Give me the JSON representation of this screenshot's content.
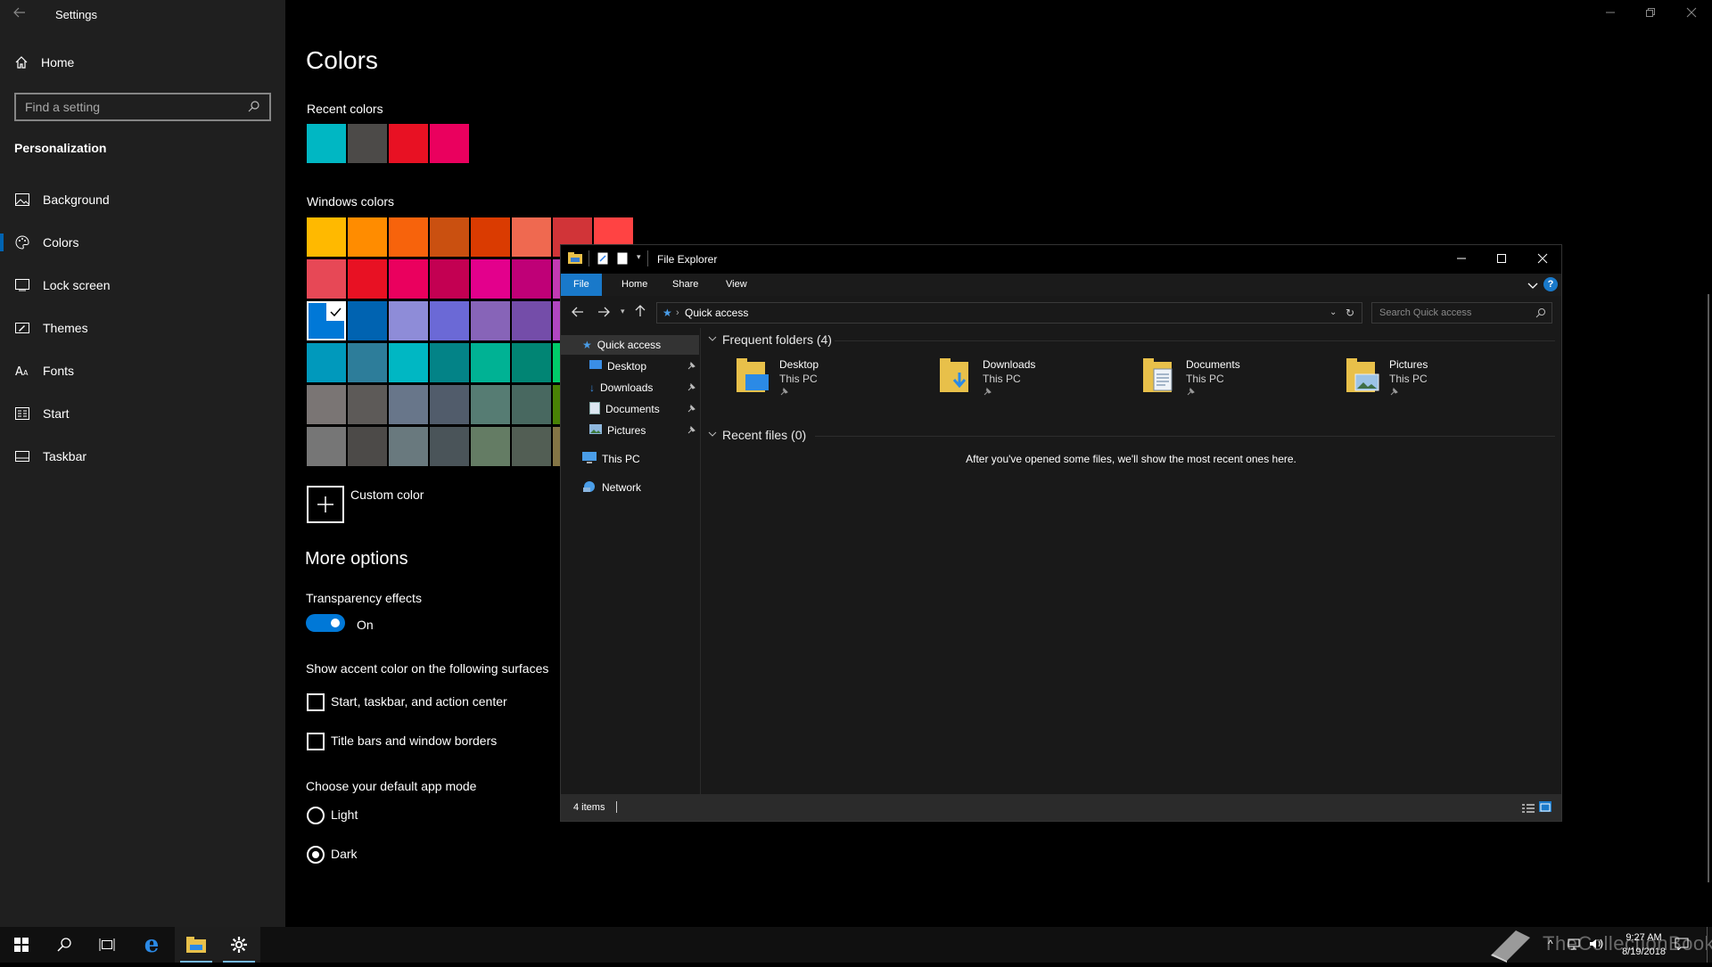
{
  "settings": {
    "window_title": "Settings",
    "home_label": "Home",
    "search_placeholder": "Find a setting",
    "section_label": "Personalization",
    "nav": [
      {
        "label": "Background",
        "icon": "picture-icon"
      },
      {
        "label": "Colors",
        "icon": "palette-icon",
        "active": true
      },
      {
        "label": "Lock screen",
        "icon": "lock-screen-icon"
      },
      {
        "label": "Themes",
        "icon": "brush-icon"
      },
      {
        "label": "Fonts",
        "icon": "font-icon"
      },
      {
        "label": "Start",
        "icon": "start-grid-icon"
      },
      {
        "label": "Taskbar",
        "icon": "taskbar-icon"
      }
    ],
    "page_title": "Colors",
    "recent_colors_label": "Recent colors",
    "recent_colors": [
      "#00b7c3",
      "#4c4a48",
      "#e81123",
      "#ea005e"
    ],
    "windows_colors_label": "Windows colors",
    "windows_colors": [
      [
        "#ffb900",
        "#ff8c00",
        "#f7630c",
        "#ca5010",
        "#da3b01",
        "#ef6950",
        "#d13438",
        "#ff4343"
      ],
      [
        "#e74856",
        "#e81123",
        "#ea005e",
        "#c30052",
        "#e3008c",
        "#bf0077",
        "#c239b3",
        "#9a0089"
      ],
      [
        "#0078d7",
        "#0063b1",
        "#8e8cd8",
        "#6b69d6",
        "#8764b8",
        "#744da9",
        "#b146c2",
        "#881798"
      ],
      [
        "#0099bc",
        "#2d7d9a",
        "#00b7c3",
        "#038387",
        "#00b294",
        "#018574",
        "#00cc6a",
        "#10893e"
      ],
      [
        "#7a7574",
        "#5d5a58",
        "#68768a",
        "#515c6b",
        "#567c73",
        "#486860",
        "#498205",
        "#107c10"
      ],
      [
        "#767676",
        "#4c4a48",
        "#69797e",
        "#4a5459",
        "#647c64",
        "#525e54",
        "#847545",
        "#7e735f"
      ]
    ],
    "selected_color": "#0078d7",
    "custom_color_label": "Custom color",
    "more_options_label": "More options",
    "transparency_label": "Transparency effects",
    "transparency_state": "On",
    "accent_surfaces_label": "Show accent color on the following surfaces",
    "checkbox_start": "Start, taskbar, and action center",
    "checkbox_titlebars": "Title bars and window borders",
    "app_mode_label": "Choose your default app mode",
    "mode_light": "Light",
    "mode_dark": "Dark",
    "selected_mode": "Dark",
    "accent_color": "#0078d7"
  },
  "explorer": {
    "title": "File Explorer",
    "tabs": [
      "File",
      "Home",
      "Share",
      "View"
    ],
    "address": "Quick access",
    "search_placeholder": "Search Quick access",
    "nav": {
      "quick_access": "Quick access",
      "pinned": [
        "Desktop",
        "Downloads",
        "Documents",
        "Pictures"
      ],
      "this_pc": "This PC",
      "network": "Network"
    },
    "frequent_header": "Frequent folders (4)",
    "folders": [
      {
        "name": "Desktop",
        "location": "This PC"
      },
      {
        "name": "Downloads",
        "location": "This PC"
      },
      {
        "name": "Documents",
        "location": "This PC"
      },
      {
        "name": "Pictures",
        "location": "This PC"
      }
    ],
    "recent_header": "Recent files (0)",
    "recent_empty_text": "After you've opened some files, we'll show the most recent ones here.",
    "status_items": "4 items"
  },
  "taskbar": {
    "time": "9:27 AM",
    "date": "8/19/2018",
    "watermark": "TheCollectionBook"
  }
}
